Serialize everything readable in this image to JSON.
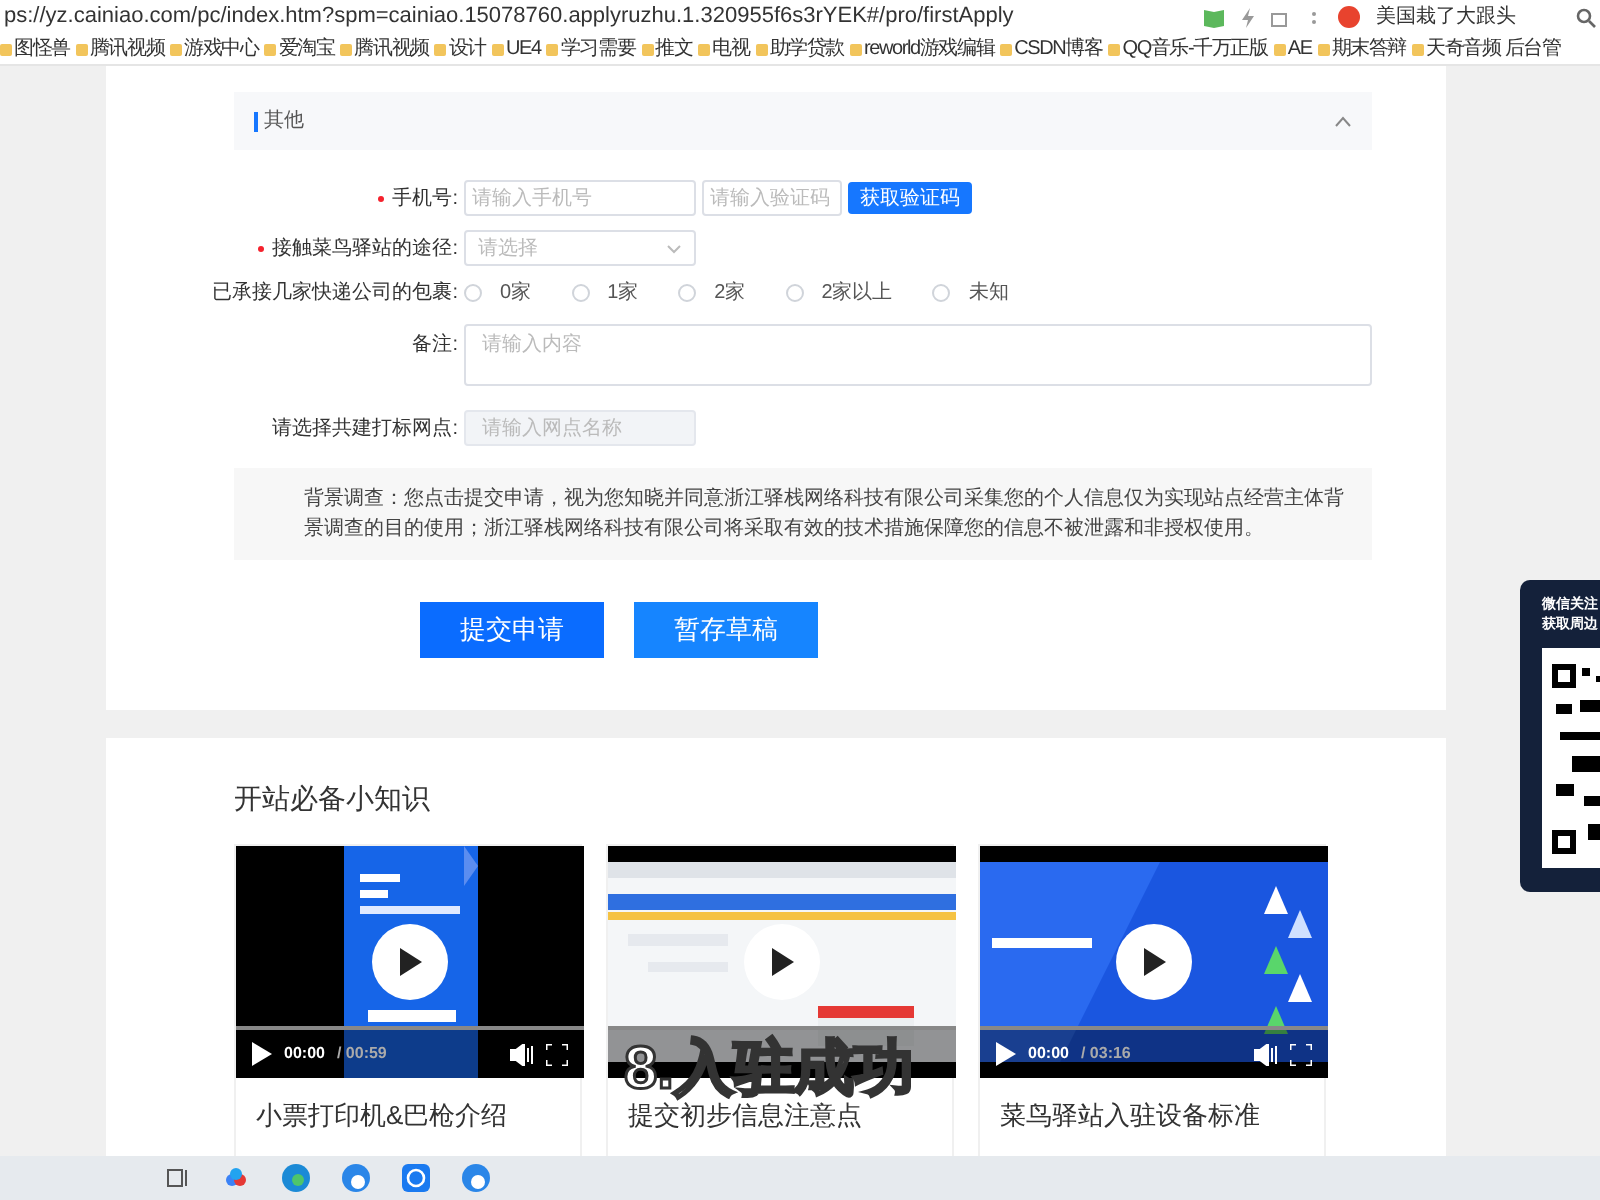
{
  "browser": {
    "url": "ps://yz.cainiao.com/pc/index.htm?spm=cainiao.15078760.applyruzhu.1.320955f6s3rYEK#/pro/firstApply",
    "news": "美国栽了大跟头",
    "bookmarks": [
      "图怪兽",
      "腾讯视频",
      "游戏中心",
      "爱淘宝",
      "腾讯视频",
      "设计",
      "UE4",
      "学习需要",
      "推文",
      "电视",
      "助学贷款",
      "reworld游戏编辑",
      "CSDN博客",
      "QQ音乐-千万正版",
      "AE",
      "期末答辩",
      "天奇音频 后台管"
    ]
  },
  "section": {
    "title": "其他",
    "expanded": true
  },
  "form": {
    "phone": {
      "label": "手机号:",
      "required": true,
      "placeholder": "请输入手机号",
      "code_placeholder": "请输入验证码",
      "button": "获取验证码"
    },
    "channel": {
      "label": "接触菜鸟驿站的途径:",
      "required": true,
      "placeholder": "请选择"
    },
    "parcels": {
      "label": "已承接几家快递公司的包裹:",
      "options": [
        {
          "label": "0家",
          "selected": false
        },
        {
          "label": "1家",
          "selected": false
        },
        {
          "label": "2家",
          "selected": false
        },
        {
          "label": "2家以上",
          "selected": false
        },
        {
          "label": "未知",
          "selected": false
        }
      ]
    },
    "remark": {
      "label": "备注:",
      "placeholder": "请输入内容"
    },
    "network": {
      "label": "请选择共建打标网点:",
      "placeholder": "请输入网点名称",
      "disabled": true
    }
  },
  "notice": "背景调查：您点击提交申请，视为您知晓并同意浙江驿栈网络科技有限公司采集您的个人信息仅为实现站点经营主体背景调查的目的使用；浙江驿栈网络科技有限公司将采取有效的技术措施保障您的信息不被泄露和非授权使用。",
  "buttons": [
    "提交申请",
    "暂存草稿"
  ],
  "knowledge": {
    "title": "开站必备小知识",
    "videos": [
      {
        "kind": "dark",
        "controls": true,
        "current": "00:00",
        "duration": "/ 00:59",
        "title": "小票打印机&巴枪介绍"
      },
      {
        "kind": "light",
        "controls": false,
        "title": "提交初步信息注意点"
      },
      {
        "kind": "blue",
        "controls": true,
        "current": "00:00",
        "duration": "/ 03:16",
        "title": "菜鸟驿站入驻设备标准"
      }
    ]
  },
  "qr_widget": {
    "lines": [
      "微信关注",
      "获取周边"
    ]
  },
  "subtitle": "8.入驻成功"
}
